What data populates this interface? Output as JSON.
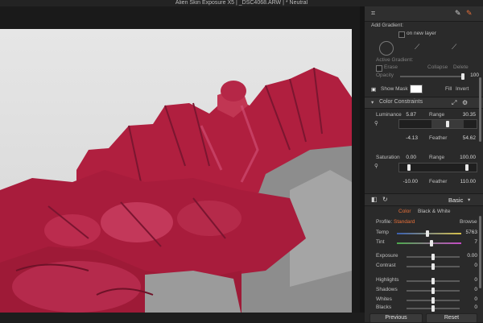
{
  "window": {
    "title": "Alien Skin Exposure X5 | _DSC4068.ARW | * Neutral"
  },
  "toolbar": {
    "crop_icon": "crop-icon",
    "brush_icon": "brush-icon",
    "brush_active_icon": "brush-active-icon"
  },
  "gradient": {
    "add_label": "Add Gradient:",
    "new_layer_label": "on new layer",
    "active_label": "Active Gradient:",
    "erase_label": "Erase",
    "collapse_label": "Collapse",
    "delete_label": "Delete",
    "opacity_label": "Opacity",
    "opacity_value": "100"
  },
  "mask": {
    "show_mask_label": "Show Mask",
    "fill_label": "Fill",
    "invert_label": "Invert"
  },
  "color_constraints": {
    "title": "Color Constraints",
    "luminance": {
      "label": "Luminance",
      "value": "5.87",
      "range_label": "Range",
      "range_value": "30.35",
      "low": "-4.13",
      "feather_label": "Feather",
      "feather_value": "54.62"
    },
    "saturation": {
      "label": "Saturation",
      "value": "0.00",
      "range_label": "Range",
      "range_value": "100.00",
      "low": "-10.00",
      "feather_label": "Feather",
      "feather_value": "110.00"
    }
  },
  "basic": {
    "title": "Basic",
    "tab_color": "Color",
    "tab_bw": "Black & White",
    "profile_label": "Profile:",
    "profile_value": "Standard",
    "browse_label": "Browse",
    "temp_label": "Temp",
    "temp_value": "5763",
    "tint_label": "Tint",
    "tint_value": "7",
    "exposure_label": "Exposure",
    "exposure_value": "0.00",
    "contrast_label": "Contrast",
    "contrast_value": "0",
    "highlights_label": "Highlights",
    "highlights_value": "0",
    "shadows_label": "Shadows",
    "shadows_value": "0",
    "whites_label": "Whites",
    "whites_value": "0",
    "blacks_label": "Blacks",
    "blacks_value": "0"
  },
  "footer": {
    "previous_label": "Previous",
    "reset_label": "Reset"
  },
  "colors": {
    "accent": "#e8703a",
    "mask_red": "#b3163a",
    "panel_bg": "#2a2a2a"
  }
}
